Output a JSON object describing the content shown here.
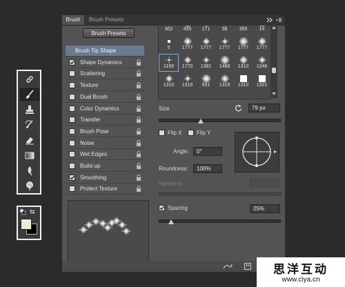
{
  "toolbar": {
    "tools": [
      {
        "name": "healing-brush-icon",
        "active": false
      },
      {
        "name": "brush-icon",
        "active": true
      },
      {
        "name": "clone-stamp-icon",
        "active": false
      },
      {
        "name": "history-brush-icon",
        "active": false
      },
      {
        "name": "eraser-icon",
        "active": false
      },
      {
        "name": "gradient-icon",
        "active": false
      },
      {
        "name": "blur-icon",
        "active": false
      },
      {
        "name": "dodge-icon",
        "active": false
      }
    ],
    "foreground_color": "#eeebd9",
    "background_color": "#000000"
  },
  "panel": {
    "tabs": [
      "Brush",
      "Brush Presets"
    ],
    "presets_button": "Brush Presets",
    "options": [
      {
        "label": "Brush Tip Shape",
        "checked": null,
        "selected": true
      },
      {
        "label": "Shape Dynamics",
        "checked": true
      },
      {
        "label": "Scattering",
        "checked": false
      },
      {
        "label": "Texture",
        "checked": false
      },
      {
        "label": "Dual Brush",
        "checked": false
      },
      {
        "label": "Color Dynamics",
        "checked": false
      },
      {
        "label": "Transfer",
        "checked": false
      },
      {
        "label": "Brush Pose",
        "checked": false
      },
      {
        "label": "Noise",
        "checked": false
      },
      {
        "label": "Wet Edges",
        "checked": false
      },
      {
        "label": "Build-up",
        "checked": false
      },
      {
        "label": "Smoothing",
        "checked": true
      },
      {
        "label": "Protect Texture",
        "checked": false
      }
    ],
    "brush_tips": [
      [
        "302",
        "435",
        "171",
        "58",
        "355",
        "14"
      ],
      [
        "5",
        "1777",
        "1777",
        "1777",
        "1777",
        "1777"
      ],
      [
        "1199",
        "1770",
        "1381",
        "1468",
        "1310",
        "1246"
      ],
      [
        "1310",
        "1319",
        "931",
        "1319",
        "1310",
        "1321"
      ]
    ],
    "size": {
      "label": "Size",
      "value": "79 px",
      "reset_icon": "reset-icon",
      "level": 0.35
    },
    "flip_x": {
      "label": "Flip X",
      "checked": false
    },
    "flip_y": {
      "label": "Flip Y",
      "checked": false
    },
    "angle": {
      "label": "Angle:",
      "value": "0°"
    },
    "roundness": {
      "label": "Roundness:",
      "value": "100%"
    },
    "hardness": {
      "label": "Hardness",
      "value": ""
    },
    "spacing": {
      "label": "Spacing",
      "checked": true,
      "value": "25%",
      "level": 0.1
    }
  },
  "watermark": {
    "title": "思洋互动",
    "url": "www.ciya.cn"
  }
}
